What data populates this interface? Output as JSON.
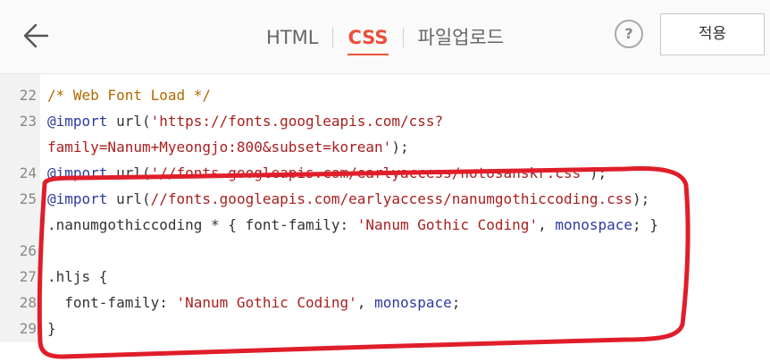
{
  "tabs": [
    {
      "label": "HTML",
      "active": false
    },
    {
      "label": "CSS",
      "active": true
    },
    {
      "label": "파일업로드",
      "active": false
    }
  ],
  "help_label": "?",
  "apply_label": "적용",
  "lines": [
    {
      "num": "22",
      "parts": [
        {
          "t": "/* Web Font Load */",
          "c": "comment"
        }
      ]
    },
    {
      "num": "23",
      "parts": [
        {
          "t": "@import",
          "c": "at"
        },
        {
          "t": " url(",
          "c": "plain"
        },
        {
          "t": "'https://fonts.googleapis.com/css?",
          "c": "str"
        }
      ]
    },
    {
      "num": "",
      "parts": [
        {
          "t": "family=Nanum+Myeongjo:800&subset=korean'",
          "c": "str"
        },
        {
          "t": ");",
          "c": "plain"
        }
      ]
    },
    {
      "num": "24",
      "parts": [
        {
          "t": "@import",
          "c": "at"
        },
        {
          "t": " url(",
          "c": "plain"
        },
        {
          "t": "'//fonts.googleapis.com/earlyaccess/notosanskr.css'",
          "c": "str"
        },
        {
          "t": ");",
          "c": "plain"
        }
      ]
    },
    {
      "num": "25",
      "parts": [
        {
          "t": "@import",
          "c": "at"
        },
        {
          "t": " url(",
          "c": "plain"
        },
        {
          "t": "//fonts.googleapis.com/earlyaccess/nanumgothiccoding.css",
          "c": "str"
        },
        {
          "t": ");",
          "c": "plain"
        }
      ]
    },
    {
      "num": "",
      "parts": [
        {
          "t": ".nanumgothiccoding * { font-family: ",
          "c": "plain"
        },
        {
          "t": "'Nanum Gothic Coding'",
          "c": "str"
        },
        {
          "t": ", ",
          "c": "plain"
        },
        {
          "t": "monospace",
          "c": "kw"
        },
        {
          "t": "; }",
          "c": "plain"
        }
      ]
    },
    {
      "num": "26",
      "parts": []
    },
    {
      "num": "27",
      "parts": [
        {
          "t": ".hljs {",
          "c": "plain"
        }
      ]
    },
    {
      "num": "28",
      "parts": [
        {
          "t": "  font-family: ",
          "c": "plain"
        },
        {
          "t": "'Nanum Gothic Coding'",
          "c": "str"
        },
        {
          "t": ", ",
          "c": "plain"
        },
        {
          "t": "monospace",
          "c": "kw"
        },
        {
          "t": ";",
          "c": "plain"
        }
      ]
    },
    {
      "num": "29",
      "parts": [
        {
          "t": "}",
          "c": "plain"
        }
      ]
    }
  ],
  "colors": {
    "accent": "#e8503a",
    "annotation": "#e01e2a"
  }
}
